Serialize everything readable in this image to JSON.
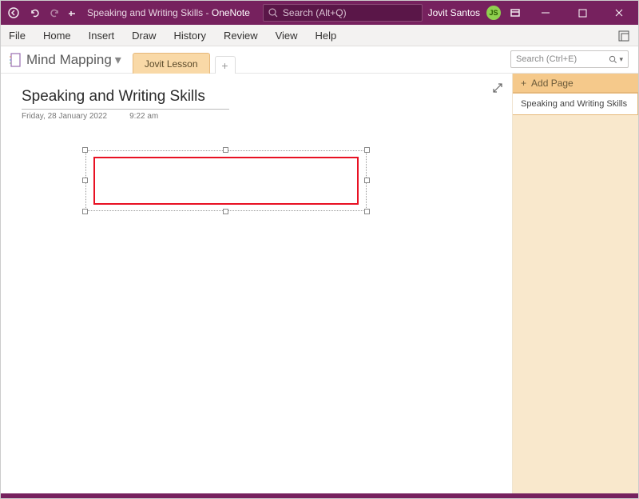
{
  "titlebar": {
    "doc_title": "Speaking and Writing Skills",
    "separator": " - ",
    "app_name": "OneNote",
    "search_placeholder": "Search (Alt+Q)",
    "user_name": "Jovit Santos",
    "user_initials": "JS"
  },
  "ribbon": {
    "items": [
      "File",
      "Home",
      "Insert",
      "Draw",
      "History",
      "Review",
      "View",
      "Help"
    ]
  },
  "notebook": {
    "name": "Mind Mapping",
    "tabs": [
      {
        "label": "Jovit Lesson",
        "active": true
      }
    ],
    "search_placeholder": "Search (Ctrl+E)"
  },
  "pagelist": {
    "add_label": "Add Page",
    "pages": [
      {
        "title": "Speaking and Writing Skills",
        "selected": true
      }
    ]
  },
  "page": {
    "title": "Speaking and Writing Skills",
    "date": "Friday, 28 January 2022",
    "time": "9:22 am"
  },
  "colors": {
    "brand": "#76215e",
    "section_tab": "#f9d9a7",
    "page_panel": "#f9e8cc",
    "add_page": "#f5c98b",
    "highlight_rect": "#e81123"
  }
}
